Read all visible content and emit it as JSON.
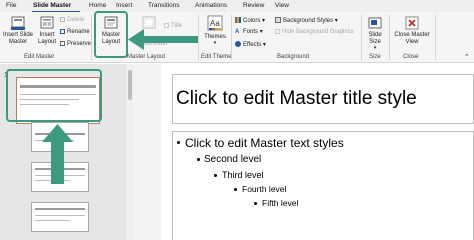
{
  "tabs": [
    "File",
    "Slide Master",
    "Home",
    "Insert",
    "Transitions",
    "Animations",
    "Review",
    "View"
  ],
  "ribbon": {
    "insert_slide_master": "Insert Slide Master",
    "insert_layout": "Insert Layout",
    "delete": "Delete",
    "rename": "Rename",
    "preserve": "Preserve",
    "master_layout": "Master Layout",
    "insert_placeholder": "Placeholder",
    "title": "Title",
    "footers": "Footers",
    "themes": "Themes",
    "colors": "Colors",
    "fonts": "Fonts",
    "effects": "Effects",
    "background_styles": "Background Styles",
    "hide_background_graphics": "Hide Background Graphics",
    "slide_size": "Slide Size",
    "close_master_view": "Close Master View",
    "groups": {
      "edit_master": "Edit Master",
      "master_layout": "Master Layout",
      "edit_theme": "Edit Theme",
      "background": "Background",
      "size": "Size",
      "close": "Close"
    }
  },
  "thumbnails": {
    "first_number": "1"
  },
  "slide": {
    "title": "Click to edit Master title style",
    "levels": [
      "Click to edit Master text styles",
      "Second level",
      "Third level",
      "Fourth level",
      "Fifth level"
    ]
  },
  "colors": {
    "highlight": "#3d9a80",
    "accent": "#2b579a"
  }
}
